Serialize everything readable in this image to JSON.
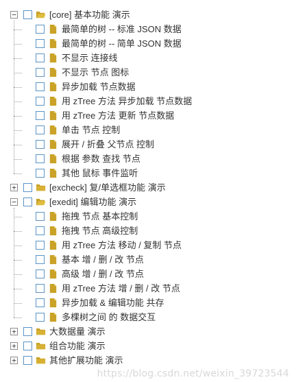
{
  "tree": [
    {
      "label": "[core] 基本功能 演示",
      "open": true,
      "checked": false,
      "children": [
        {
          "label": "最简单的树 -- 标准 JSON 数据",
          "checked": false
        },
        {
          "label": "最简单的树 -- 简单 JSON 数据",
          "checked": false
        },
        {
          "label": "不显示 连接线",
          "checked": false
        },
        {
          "label": "不显示 节点 图标",
          "checked": false
        },
        {
          "label": "异步加载 节点数据",
          "checked": false
        },
        {
          "label": "用 zTree 方法 异步加载 节点数据",
          "checked": false
        },
        {
          "label": "用 zTree 方法 更新 节点数据",
          "checked": false
        },
        {
          "label": "单击 节点 控制",
          "checked": false
        },
        {
          "label": "展开 / 折叠 父节点 控制",
          "checked": false
        },
        {
          "label": "根据 参数 查找 节点",
          "checked": false
        },
        {
          "label": "其他 鼠标 事件监听",
          "checked": false
        }
      ]
    },
    {
      "label": "[excheck] 复/单选框功能 演示",
      "open": false,
      "checked": false,
      "children": []
    },
    {
      "label": "[exedit] 编辑功能 演示",
      "open": true,
      "checked": false,
      "children": [
        {
          "label": "拖拽 节点 基本控制",
          "checked": false
        },
        {
          "label": "拖拽 节点 高级控制",
          "checked": false
        },
        {
          "label": "用 zTree 方法 移动 / 复制 节点",
          "checked": false
        },
        {
          "label": "基本 增 / 删 / 改 节点",
          "checked": false
        },
        {
          "label": "高级 增 / 删 / 改 节点",
          "checked": false
        },
        {
          "label": "用 zTree 方法 增 / 删 / 改 节点",
          "checked": false
        },
        {
          "label": "异步加载 & 编辑功能 共存",
          "checked": false
        },
        {
          "label": "多棵树之间 的 数据交互",
          "checked": false
        }
      ]
    },
    {
      "label": "大数据量 演示",
      "open": false,
      "checked": false,
      "children": []
    },
    {
      "label": "组合功能 演示",
      "open": false,
      "checked": false,
      "children": []
    },
    {
      "label": "其他扩展功能 演示",
      "open": false,
      "checked": false,
      "children": []
    }
  ],
  "icons": {
    "expanded": "minus-switch-icon",
    "collapsed": "plus-switch-icon",
    "folder_open": "folder-open-icon",
    "folder_closed": "folder-closed-icon",
    "leaf": "document-icon"
  },
  "colors": {
    "checkbox_border": "#5b93c6",
    "folder": "#c9a227",
    "leaf": "#c9a227",
    "connector": "#9a9a9a",
    "text": "#333333",
    "watermark": "#d8d8d8"
  },
  "watermark": "https://blog.csdn.net/weixin_39723544"
}
